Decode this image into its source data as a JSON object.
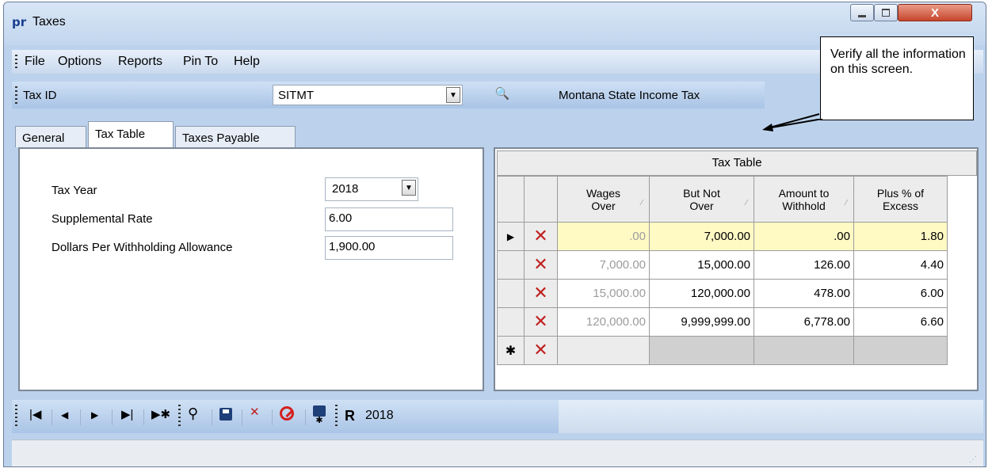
{
  "window": {
    "title": "Taxes",
    "logo_text": "pr",
    "min_icon": "minimize-icon",
    "max_icon": "maximize-icon",
    "close_icon": "close-icon",
    "close_label": "X"
  },
  "menu": [
    "File",
    "Options",
    "Reports",
    "Pin To",
    "Help"
  ],
  "taxid": {
    "label": "Tax ID",
    "value": "SITMT",
    "description": "Montana State Income Tax",
    "lookup_icon": "binoculars-icon"
  },
  "tabs": [
    {
      "label": "General",
      "active": false
    },
    {
      "label": "Tax Table",
      "active": true
    },
    {
      "label": "Taxes Payable",
      "active": false
    }
  ],
  "general_fields": {
    "tax_year_label": "Tax Year",
    "tax_year_value": "2018",
    "supplemental_rate_label": "Supplemental Rate",
    "supplemental_rate_value": "6.00",
    "dollars_per_allowance_label": "Dollars Per Withholding Allowance",
    "dollars_per_allowance_value": "1,900.00"
  },
  "tax_table": {
    "caption": "Tax Table",
    "columns": [
      {
        "line1": "Wages",
        "line2": "Over"
      },
      {
        "line1": "But Not",
        "line2": "Over"
      },
      {
        "line1": "Amount to",
        "line2": "Withhold"
      },
      {
        "line1": "Plus % of",
        "line2": "Excess"
      }
    ],
    "rows": [
      {
        "current": true,
        "wages_over": ".00",
        "but_not_over": "7,000.00",
        "amount": ".00",
        "plus_pct": "1.80"
      },
      {
        "current": false,
        "wages_over": "7,000.00",
        "but_not_over": "15,000.00",
        "amount": "126.00",
        "plus_pct": "4.40"
      },
      {
        "current": false,
        "wages_over": "15,000.00",
        "but_not_over": "120,000.00",
        "amount": "478.00",
        "plus_pct": "6.00"
      },
      {
        "current": false,
        "wages_over": "120,000.00",
        "but_not_over": "9,999,999.00",
        "amount": "6,778.00",
        "plus_pct": "6.60"
      }
    ],
    "current_row_marker": "▶",
    "new_row_marker": "✱",
    "delete_icon": "delete-x-icon"
  },
  "toolbar": {
    "year": "2018",
    "icons": [
      "first-record-icon",
      "previous-record-icon",
      "next-record-icon",
      "last-record-icon",
      "new-record-icon",
      "find-icon",
      "save-icon",
      "delete-icon",
      "cancel-icon",
      "save-new-icon",
      "report-icon"
    ]
  },
  "callout": {
    "text": "Verify all the information on this screen."
  }
}
